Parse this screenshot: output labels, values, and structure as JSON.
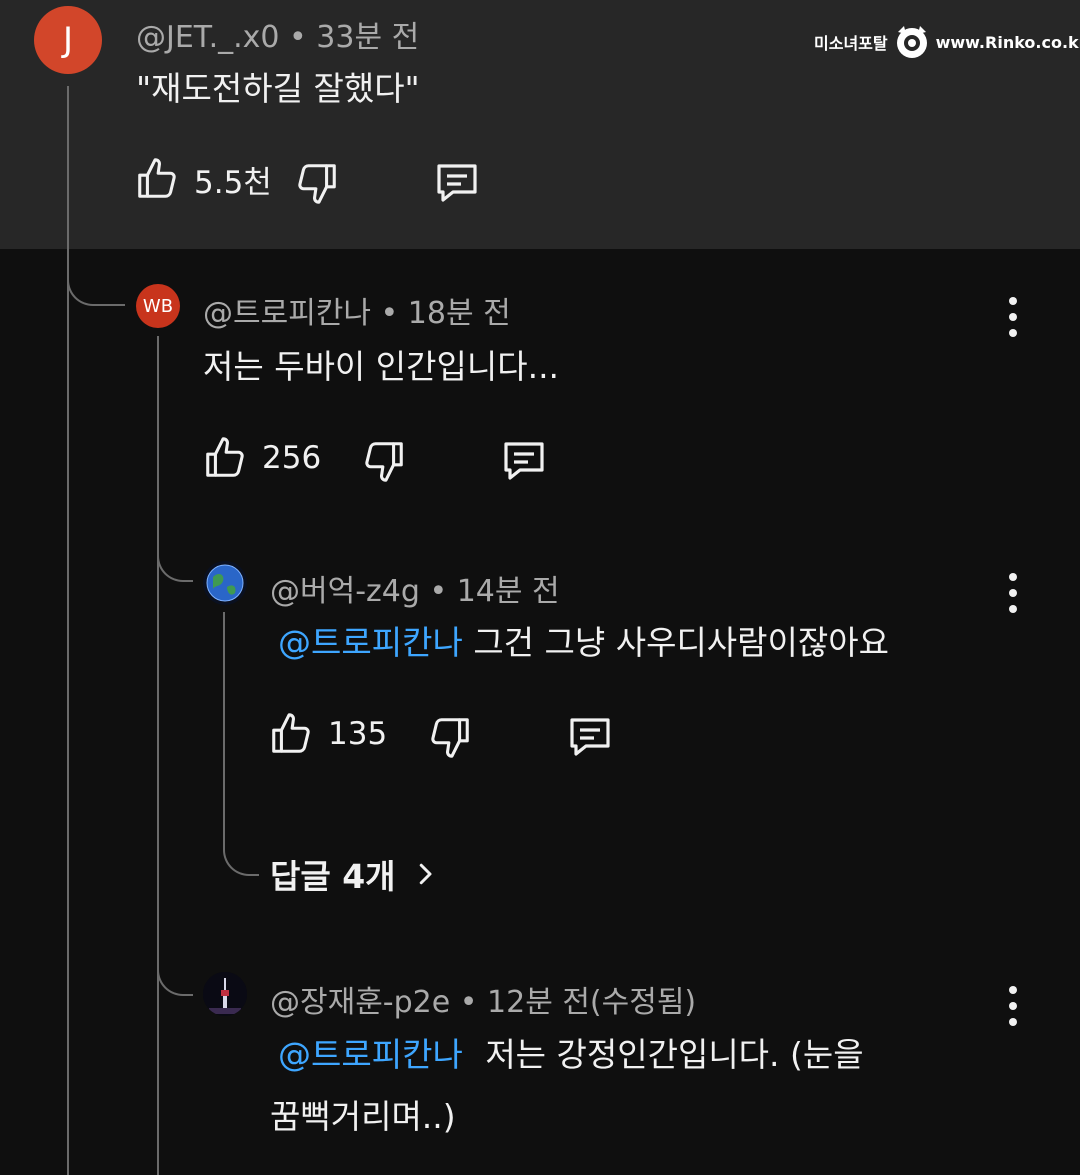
{
  "watermark": {
    "left_text": "미소녀포탈",
    "right_text": "www.Rinko.co.kr"
  },
  "comment": {
    "avatar_letter": "J",
    "author": "@JET._.x0",
    "time": "33분 전",
    "text": "\"재도전하길 잘했다\"",
    "likes": "5.5천"
  },
  "replies": [
    {
      "avatar_text": "WB",
      "author": "@트로피칸나",
      "time": "18분 전",
      "text": "저는 두바이 인간입니다...",
      "likes": "256"
    },
    {
      "author": "@버억-z4g",
      "time": "14분 전",
      "mention": "@트로피칸나",
      "text": "그건 그냥 사우디사람이잖아요",
      "likes": "135",
      "more_replies": "답글 4개"
    },
    {
      "author": "@장재훈-p2e",
      "time": "12분 전(수정됨)",
      "mention": "@트로피칸나",
      "text_line1": "저는 강정인간입니다. (눈을",
      "text_line2": "꿈뻑거리며..)"
    }
  ],
  "colors": {
    "mention": "#3ea6ff",
    "avatar_j": "#d2462a",
    "avatar_wb": "#c8341c",
    "top_band": "#272727",
    "background": "#0f0f0f"
  },
  "separator": "•"
}
